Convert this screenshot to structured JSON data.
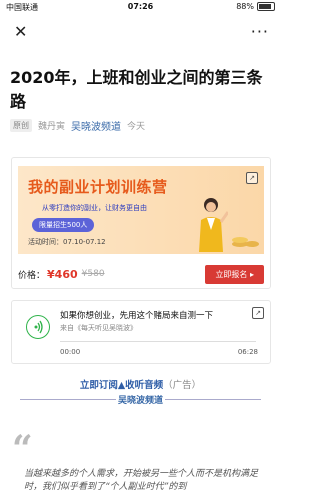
{
  "status_bar": {
    "carrier": "中国联通",
    "time": "07:26",
    "battery": "88%",
    "battery_level": 0.88
  },
  "nav": {
    "close_glyph": "✕",
    "more_glyph": "···"
  },
  "article": {
    "title": "2020年，上班和创业之间的第三条路",
    "tag": "原创",
    "author": "魏丹寅",
    "account": "吴晓波频道",
    "date": "今天"
  },
  "ad_card": {
    "banner_title": "我的副业计划训练营",
    "banner_sub": "从零打造你的副业，让财务更自由",
    "pill": "限量招生500人",
    "dates": "活动时间：07.10-07.12",
    "price_label": "价格：",
    "price_now": "¥460",
    "price_old": "¥580",
    "buy_label": "立即报名 ▸",
    "colors": {
      "accent": "#e65a1c",
      "button": "#d83a34"
    }
  },
  "audio_card": {
    "title": "如果你想创业，先用这个赌局来自测一下",
    "source": "来自《每天听见吴晓波》",
    "start": "00:00",
    "end": "06:28"
  },
  "subscribe": {
    "link": "立即订阅▲收听音频",
    "ad": "（广告）",
    "brand": "吴晓波频道"
  },
  "body": {
    "quote_glyph": "“",
    "paragraph": "当越来越多的个人需求，开始被另一些个人而不是机构满足时，我们似乎看到了“个人副业时代”的到"
  }
}
